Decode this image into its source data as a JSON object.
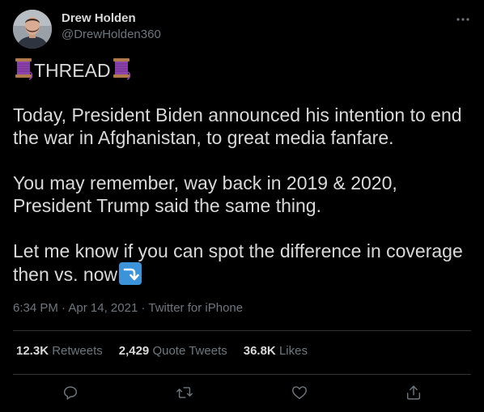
{
  "author": {
    "display_name": "Drew Holden",
    "handle": "@DrewHolden360",
    "avatar_icon": "user-avatar-photo"
  },
  "tweet": {
    "thread_label": "THREAD",
    "thread_emoji_icon": "spool-of-thread-icon",
    "paragraph_1": "Today, President Biden announced his intention to end the war in Afghanistan, to great media fanfare.",
    "paragraph_2": "You may remember, way back in 2019 & 2020, President Trump said the same thing.",
    "paragraph_3": "Let me know if you can spot the difference in coverage then vs. now",
    "trailing_emoji_icon": "right-arrow-curving-down-icon"
  },
  "meta": {
    "time": "6:34 PM",
    "separator": "·",
    "date": "Apr 14, 2021",
    "source": "Twitter for iPhone"
  },
  "stats": {
    "retweets_count": "12.3K",
    "retweets_label": "Retweets",
    "quotes_count": "2,429",
    "quotes_label": "Quote Tweets",
    "likes_count": "36.8K",
    "likes_label": "Likes"
  },
  "actions": {
    "reply_icon": "reply-icon",
    "retweet_icon": "retweet-icon",
    "like_icon": "heart-icon",
    "share_icon": "share-icon"
  },
  "colors": {
    "background": "#000000",
    "primary_text": "#d9d9d9",
    "secondary_text": "#6e767d",
    "divider": "#2f3336",
    "arrow_emoji_bg": "#3b94d9"
  }
}
